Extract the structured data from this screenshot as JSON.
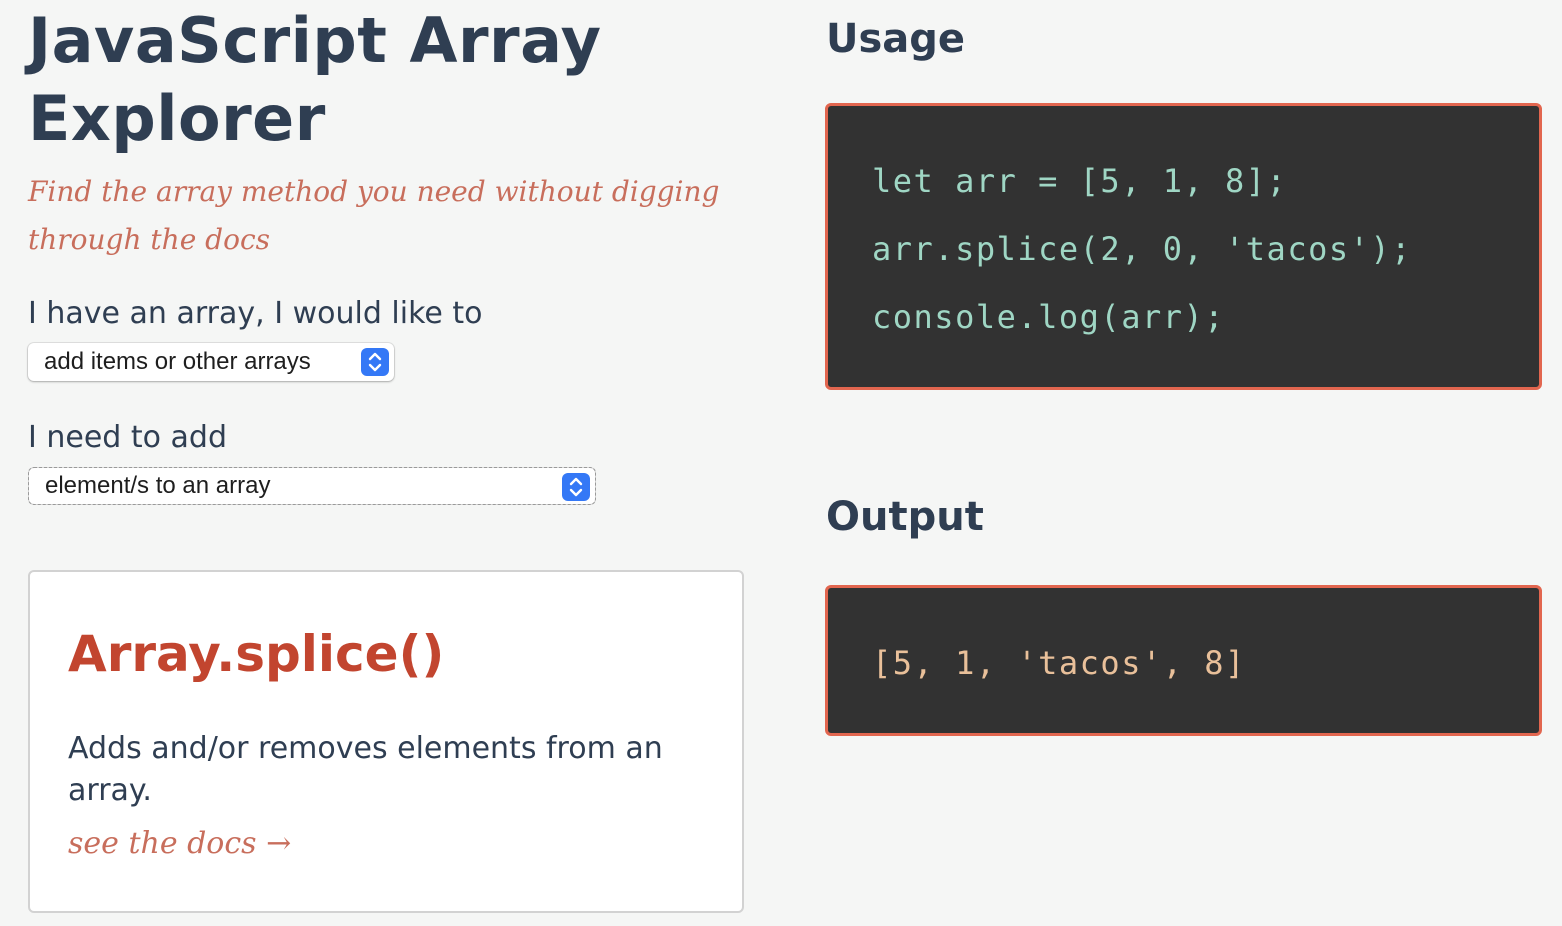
{
  "header": {
    "title_line1": "JavaScript Array",
    "title_line2": "Explorer",
    "subtitle": "Find the array method you need without digging through the docs"
  },
  "form": {
    "primary_label": "I have an array, I would like to",
    "primary_selected": "add items or other arrays",
    "secondary_label": "I need to add",
    "secondary_selected": "element/s to an array"
  },
  "method_card": {
    "name": "Array.splice()",
    "description": "Adds and/or removes elements from an array.",
    "docs_link": "see the docs →"
  },
  "usage": {
    "heading": "Usage",
    "lines": [
      "let arr = [5, 1, 8];",
      "arr.splice(2, 0, 'tacos');",
      "console.log(arr);"
    ]
  },
  "output": {
    "heading": "Output",
    "value": "[5, 1, 'tacos', 8]"
  },
  "colors": {
    "accent": "#c2452f",
    "code_border": "#e2664f",
    "code_background": "#323232",
    "select_accent": "#3478f6"
  }
}
